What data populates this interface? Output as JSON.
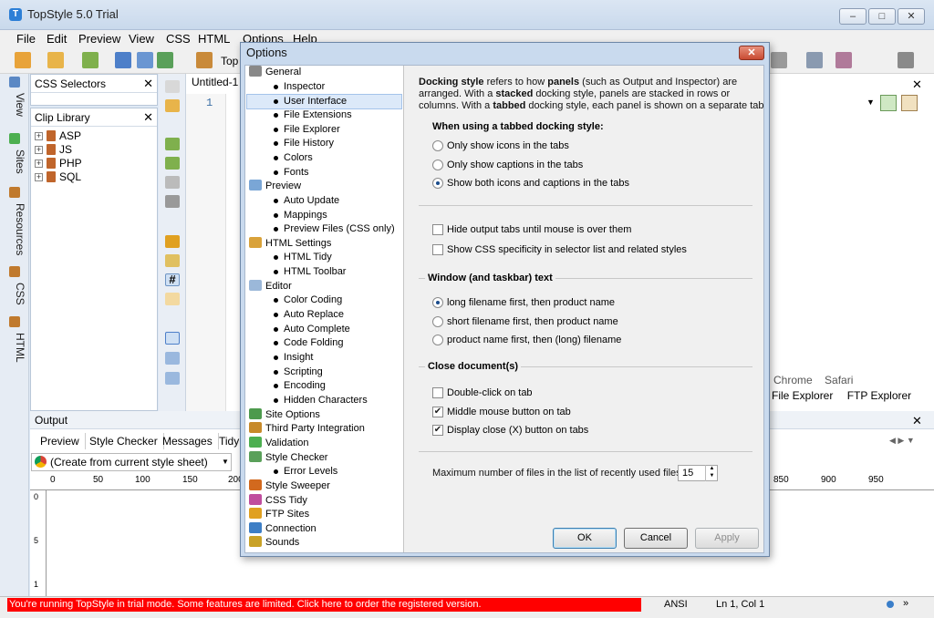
{
  "window": {
    "title": "TopStyle 5.0 Trial",
    "app_icon": "topstyle-logo-icon"
  },
  "menu": [
    "File",
    "Edit",
    "Preview",
    "View",
    "CSS",
    "HTML",
    "Options",
    "Help"
  ],
  "side_tabs": [
    "View",
    "Sites",
    "Resources",
    "CSS",
    "HTML"
  ],
  "panels": {
    "css_selectors": "CSS Selectors",
    "clip_library": "Clip Library",
    "clip_items": [
      "ASP",
      "JS",
      "PHP",
      "SQL"
    ]
  },
  "editor": {
    "tab": "Untitled-1",
    "toolbar_label": "Top",
    "line": "1"
  },
  "right": {
    "browsers": [
      "Chrome",
      "Safari"
    ],
    "explorers": [
      "File Explorer",
      "FTP Explorer"
    ]
  },
  "output": {
    "title": "Output",
    "tabs": [
      "Preview",
      "Style Checker",
      "Messages",
      "Tidy"
    ],
    "combo": "(Create from current style sheet)",
    "ruler_left": [
      "0",
      "50",
      "100",
      "150",
      "200"
    ],
    "ruler_right": [
      "850",
      "900",
      "950"
    ],
    "vruler": [
      "0",
      "5",
      "1"
    ]
  },
  "status": {
    "trial": "You're running TopStyle in trial mode. Some features are limited. Click here to order the registered version.",
    "encoding": "ANSI",
    "position": "Ln 1, Col 1"
  },
  "dialog": {
    "title": "Options",
    "nav": [
      {
        "label": "General",
        "type": "cat",
        "icon": "wrench-icon",
        "color": "#888"
      },
      {
        "label": "Inspector",
        "type": "sub"
      },
      {
        "label": "User Interface",
        "type": "sub",
        "selected": true
      },
      {
        "label": "File Extensions",
        "type": "sub"
      },
      {
        "label": "File Explorer",
        "type": "sub"
      },
      {
        "label": "File History",
        "type": "sub"
      },
      {
        "label": "Colors",
        "type": "sub"
      },
      {
        "label": "Fonts",
        "type": "sub"
      },
      {
        "label": "Preview",
        "type": "cat",
        "icon": "preview-icon",
        "color": "#7aa6d6"
      },
      {
        "label": "Auto Update",
        "type": "sub"
      },
      {
        "label": "Mappings",
        "type": "sub"
      },
      {
        "label": "Preview Files (CSS only)",
        "type": "sub"
      },
      {
        "label": "HTML Settings",
        "type": "cat",
        "icon": "html-icon",
        "color": "#d9a23a"
      },
      {
        "label": "HTML Tidy",
        "type": "sub"
      },
      {
        "label": "HTML Toolbar",
        "type": "sub"
      },
      {
        "label": "Editor",
        "type": "cat",
        "icon": "editor-icon",
        "color": "#9bb8d9"
      },
      {
        "label": "Color Coding",
        "type": "sub"
      },
      {
        "label": "Auto Replace",
        "type": "sub"
      },
      {
        "label": "Auto Complete",
        "type": "sub"
      },
      {
        "label": "Code Folding",
        "type": "sub"
      },
      {
        "label": "Insight",
        "type": "sub"
      },
      {
        "label": "Scripting",
        "type": "sub"
      },
      {
        "label": "Encoding",
        "type": "sub"
      },
      {
        "label": "Hidden Characters",
        "type": "sub"
      },
      {
        "label": "Site Options",
        "type": "cat",
        "icon": "globe-icon",
        "color": "#4d9a4d"
      },
      {
        "label": "Third Party Integration",
        "type": "cat",
        "icon": "integration-icon",
        "color": "#c78a2a"
      },
      {
        "label": "Validation",
        "type": "cat",
        "icon": "validation-icon",
        "color": "#4caf50"
      },
      {
        "label": "Style Checker",
        "type": "cat",
        "icon": "style-checker-icon",
        "color": "#5aa05a"
      },
      {
        "label": "Error Levels",
        "type": "sub"
      },
      {
        "label": "Style Sweeper",
        "type": "cat",
        "icon": "sweeper-icon",
        "color": "#d2691e"
      },
      {
        "label": "CSS Tidy",
        "type": "cat",
        "icon": "css-tidy-icon",
        "color": "#c04d9e"
      },
      {
        "label": "FTP Sites",
        "type": "cat",
        "icon": "ftp-icon",
        "color": "#e0a020"
      },
      {
        "label": "Connection",
        "type": "cat",
        "icon": "connection-icon",
        "color": "#3d7ec5"
      },
      {
        "label": "Sounds",
        "type": "cat",
        "icon": "sounds-icon",
        "color": "#c9a227"
      }
    ],
    "intro": {
      "l1a": "Docking style",
      "l1b": " refers to how ",
      "l1c": "panels",
      "l1d": " (such as Output and Inspector) are",
      "l2a": "arranged.  With a ",
      "l2b": "stacked",
      "l2c": " docking style, panels are stacked in rows or",
      "l3a": "columns.  With a ",
      "l3b": "tabbed",
      "l3c": " docking style, each panel is shown on a separate tab"
    },
    "tabbed_header": "When using a tabbed docking style:",
    "tabbed_options": [
      {
        "label": "Only show icons in the tabs",
        "selected": false
      },
      {
        "label": "Only show captions in the tabs",
        "selected": false
      },
      {
        "label": "Show both icons and captions in the tabs",
        "selected": true
      }
    ],
    "checks1": [
      {
        "label": "Hide output tabs until mouse is over them",
        "checked": false
      },
      {
        "label": "Show CSS specificity in selector list and related styles",
        "checked": false
      }
    ],
    "window_header": "Window (and taskbar) text",
    "window_options": [
      {
        "label": "long filename first, then product name",
        "selected": true
      },
      {
        "label": "short filename first, then product name",
        "selected": false
      },
      {
        "label": "product name first, then (long) filename",
        "selected": false
      }
    ],
    "close_header": "Close document(s)",
    "close_checks": [
      {
        "label": "Double-click on tab",
        "checked": false
      },
      {
        "label": "Middle mouse button on tab",
        "checked": true
      },
      {
        "label": "Display close (X) button on tabs",
        "checked": true
      }
    ],
    "recent_label": "Maximum number of files in the list of recently used files:",
    "recent_value": "15",
    "buttons": {
      "ok": "OK",
      "cancel": "Cancel",
      "apply": "Apply"
    }
  }
}
